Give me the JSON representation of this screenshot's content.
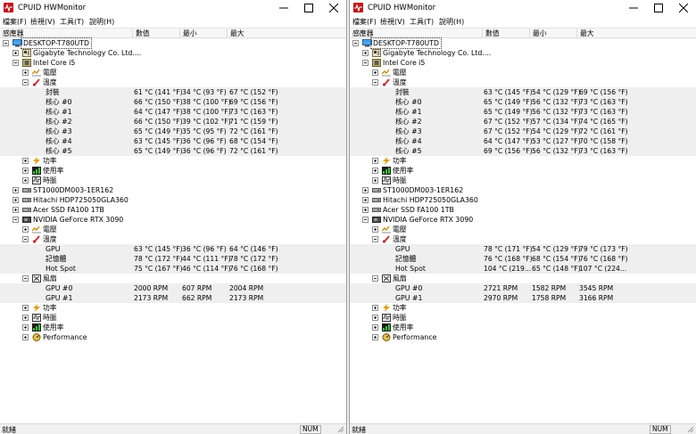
{
  "menu": [
    "檔案(F)",
    "檢視(V)",
    "工具(T)",
    "說明(H)"
  ],
  "columns": [
    "感應器",
    "數值",
    "最小",
    "最大"
  ],
  "status": {
    "text": "就緒",
    "num": "NUM"
  },
  "colors": {
    "temp_icon": "#c62828",
    "power_icon": "#e39b17",
    "clock_icon": "#4a4a4a",
    "usage_icon": "#2e7d32",
    "app_icon": "#c0161b"
  },
  "windows": [
    {
      "title": "CPUID HWMonitor",
      "rows": [
        {
          "t": "computer-icon",
          "l": 0,
          "e": "minus",
          "label": "DESKTOP-T780UTD",
          "sel": true
        },
        {
          "t": "board-icon",
          "l": 1,
          "e": "plus",
          "label": "Gigabyte Technology Co. Ltd...."
        },
        {
          "t": "cpu-icon",
          "l": 1,
          "e": "minus",
          "label": "Intel Core i5"
        },
        {
          "t": "voltage-icon",
          "l": 2,
          "e": "plus",
          "label": "電壓"
        },
        {
          "t": "temp-icon",
          "l": 2,
          "e": "minus",
          "label": "溫度"
        },
        {
          "t": "",
          "l": 3,
          "e": "",
          "label": "封裝",
          "v": "61 °C  (141 °F)",
          "mn": "34 °C  (93 °F)",
          "mx": "67 °C  (152 °F)",
          "shade": true
        },
        {
          "t": "",
          "l": 3,
          "e": "",
          "label": "核心 #0",
          "v": "66 °C  (150 °F)",
          "mn": "38 °C  (100 °F)",
          "mx": "69 °C  (156 °F)",
          "shade": true
        },
        {
          "t": "",
          "l": 3,
          "e": "",
          "label": "核心 #1",
          "v": "64 °C  (147 °F)",
          "mn": "38 °C  (100 °F)",
          "mx": "73 °C  (163 °F)",
          "shade": true
        },
        {
          "t": "",
          "l": 3,
          "e": "",
          "label": "核心 #2",
          "v": "66 °C  (150 °F)",
          "mn": "39 °C  (102 °F)",
          "mx": "71 °C  (159 °F)",
          "shade": true
        },
        {
          "t": "",
          "l": 3,
          "e": "",
          "label": "核心 #3",
          "v": "65 °C  (149 °F)",
          "mn": "35 °C  (95 °F)",
          "mx": "72 °C  (161 °F)",
          "shade": true
        },
        {
          "t": "",
          "l": 3,
          "e": "",
          "label": "核心 #4",
          "v": "63 °C  (145 °F)",
          "mn": "36 °C  (96 °F)",
          "mx": "68 °C  (154 °F)",
          "shade": true
        },
        {
          "t": "",
          "l": 3,
          "e": "",
          "label": "核心 #5",
          "v": "65 °C  (149 °F)",
          "mn": "36 °C  (96 °F)",
          "mx": "72 °C  (161 °F)",
          "shade": true
        },
        {
          "t": "power-icon",
          "l": 2,
          "e": "plus",
          "label": "功率"
        },
        {
          "t": "usage-icon",
          "l": 2,
          "e": "plus",
          "label": "使用率"
        },
        {
          "t": "clock-icon",
          "l": 2,
          "e": "plus",
          "label": "時脈"
        },
        {
          "t": "drive-icon",
          "l": 1,
          "e": "plus",
          "label": "ST1000DM003-1ER162"
        },
        {
          "t": "drive-icon",
          "l": 1,
          "e": "plus",
          "label": "Hitachi HDP725050GLA360"
        },
        {
          "t": "drive-icon",
          "l": 1,
          "e": "plus",
          "label": "Acer SSD FA100 1TB"
        },
        {
          "t": "gpu-icon",
          "l": 1,
          "e": "minus",
          "label": "NVIDIA GeForce RTX 3090"
        },
        {
          "t": "voltage-icon",
          "l": 2,
          "e": "plus",
          "label": "電壓"
        },
        {
          "t": "temp-icon",
          "l": 2,
          "e": "minus",
          "label": "溫度"
        },
        {
          "t": "",
          "l": 3,
          "e": "",
          "label": "GPU",
          "v": "63 °C  (145 °F)",
          "mn": "36 °C  (96 °F)",
          "mx": "64 °C  (146 °F)",
          "shade": true
        },
        {
          "t": "",
          "l": 3,
          "e": "",
          "label": "記憶體",
          "v": "78 °C  (172 °F)",
          "mn": "44 °C  (111 °F)",
          "mx": "78 °C  (172 °F)",
          "shade": true
        },
        {
          "t": "",
          "l": 3,
          "e": "",
          "label": "Hot Spot",
          "v": "75 °C  (167 °F)",
          "mn": "46 °C  (114 °F)",
          "mx": "76 °C  (168 °F)",
          "shade": true
        },
        {
          "t": "fan-icon",
          "l": 2,
          "e": "minus",
          "label": "風扇"
        },
        {
          "t": "",
          "l": 3,
          "e": "",
          "label": "GPU #0",
          "v": "2000 RPM",
          "mn": "607 RPM",
          "mx": "2004 RPM",
          "shade": true
        },
        {
          "t": "",
          "l": 3,
          "e": "",
          "label": "GPU #1",
          "v": "2173 RPM",
          "mn": "662 RPM",
          "mx": "2173 RPM",
          "shade": true
        },
        {
          "t": "power-icon",
          "l": 2,
          "e": "plus",
          "label": "功率"
        },
        {
          "t": "clock-icon",
          "l": 2,
          "e": "plus",
          "label": "時脈"
        },
        {
          "t": "usage-icon",
          "l": 2,
          "e": "plus",
          "label": "使用率"
        },
        {
          "t": "perf-icon",
          "l": 2,
          "e": "plus",
          "label": "Performance"
        }
      ]
    },
    {
      "title": "CPUID HWMonitor",
      "rows": [
        {
          "t": "computer-icon",
          "l": 0,
          "e": "minus",
          "label": "DESKTOP-T780UTD",
          "sel": true
        },
        {
          "t": "board-icon",
          "l": 1,
          "e": "plus",
          "label": "Gigabyte Technology Co. Ltd...."
        },
        {
          "t": "cpu-icon",
          "l": 1,
          "e": "minus",
          "label": "Intel Core i5"
        },
        {
          "t": "voltage-icon",
          "l": 2,
          "e": "plus",
          "label": "電壓"
        },
        {
          "t": "temp-icon",
          "l": 2,
          "e": "minus",
          "label": "溫度"
        },
        {
          "t": "",
          "l": 3,
          "e": "",
          "label": "封裝",
          "v": "63 °C  (145 °F)",
          "mn": "54 °C  (129 °F)",
          "mx": "69 °C  (156 °F)",
          "shade": true
        },
        {
          "t": "",
          "l": 3,
          "e": "",
          "label": "核心 #0",
          "v": "65 °C  (149 °F)",
          "mn": "56 °C  (132 °F)",
          "mx": "73 °C  (163 °F)",
          "shade": true
        },
        {
          "t": "",
          "l": 3,
          "e": "",
          "label": "核心 #1",
          "v": "65 °C  (149 °F)",
          "mn": "56 °C  (132 °F)",
          "mx": "73 °C  (163 °F)",
          "shade": true
        },
        {
          "t": "",
          "l": 3,
          "e": "",
          "label": "核心 #2",
          "v": "67 °C  (152 °F)",
          "mn": "57 °C  (134 °F)",
          "mx": "74 °C  (165 °F)",
          "shade": true
        },
        {
          "t": "",
          "l": 3,
          "e": "",
          "label": "核心 #3",
          "v": "67 °C  (152 °F)",
          "mn": "54 °C  (129 °F)",
          "mx": "72 °C  (161 °F)",
          "shade": true
        },
        {
          "t": "",
          "l": 3,
          "e": "",
          "label": "核心 #4",
          "v": "64 °C  (147 °F)",
          "mn": "53 °C  (127 °F)",
          "mx": "70 °C  (158 °F)",
          "shade": true
        },
        {
          "t": "",
          "l": 3,
          "e": "",
          "label": "核心 #5",
          "v": "69 °C  (156 °F)",
          "mn": "56 °C  (132 °F)",
          "mx": "73 °C  (163 °F)",
          "shade": true
        },
        {
          "t": "power-icon",
          "l": 2,
          "e": "plus",
          "label": "功率"
        },
        {
          "t": "usage-icon",
          "l": 2,
          "e": "plus",
          "label": "使用率"
        },
        {
          "t": "clock-icon",
          "l": 2,
          "e": "plus",
          "label": "時脈"
        },
        {
          "t": "drive-icon",
          "l": 1,
          "e": "plus",
          "label": "ST1000DM003-1ER162"
        },
        {
          "t": "drive-icon",
          "l": 1,
          "e": "plus",
          "label": "Hitachi HDP725050GLA360"
        },
        {
          "t": "drive-icon",
          "l": 1,
          "e": "plus",
          "label": "Acer SSD FA100 1TB"
        },
        {
          "t": "gpu-icon",
          "l": 1,
          "e": "minus",
          "label": "NVIDIA GeForce RTX 3090"
        },
        {
          "t": "voltage-icon",
          "l": 2,
          "e": "plus",
          "label": "電壓"
        },
        {
          "t": "temp-icon",
          "l": 2,
          "e": "minus",
          "label": "溫度"
        },
        {
          "t": "",
          "l": 3,
          "e": "",
          "label": "GPU",
          "v": "78 °C  (171 °F)",
          "mn": "54 °C  (129 °F)",
          "mx": "79 °C  (173 °F)",
          "shade": true
        },
        {
          "t": "",
          "l": 3,
          "e": "",
          "label": "記憶體",
          "v": "76 °C  (168 °F)",
          "mn": "68 °C  (154 °F)",
          "mx": "76 °C  (168 °F)",
          "shade": true
        },
        {
          "t": "",
          "l": 3,
          "e": "",
          "label": "Hot Spot",
          "v": "104 °C  (219...",
          "mn": "65 °C  (148 °F)",
          "mx": "107 °C  (224...",
          "shade": true
        },
        {
          "t": "fan-icon",
          "l": 2,
          "e": "minus",
          "label": "風扇"
        },
        {
          "t": "",
          "l": 3,
          "e": "",
          "label": "GPU #0",
          "v": "2721 RPM",
          "mn": "1582 RPM",
          "mx": "3545 RPM",
          "shade": true
        },
        {
          "t": "",
          "l": 3,
          "e": "",
          "label": "GPU #1",
          "v": "2970 RPM",
          "mn": "1758 RPM",
          "mx": "3166 RPM",
          "shade": true
        },
        {
          "t": "power-icon",
          "l": 2,
          "e": "plus",
          "label": "功率"
        },
        {
          "t": "clock-icon",
          "l": 2,
          "e": "plus",
          "label": "時脈"
        },
        {
          "t": "usage-icon",
          "l": 2,
          "e": "plus",
          "label": "使用率"
        },
        {
          "t": "perf-icon",
          "l": 2,
          "e": "plus",
          "label": "Performance"
        }
      ]
    }
  ]
}
